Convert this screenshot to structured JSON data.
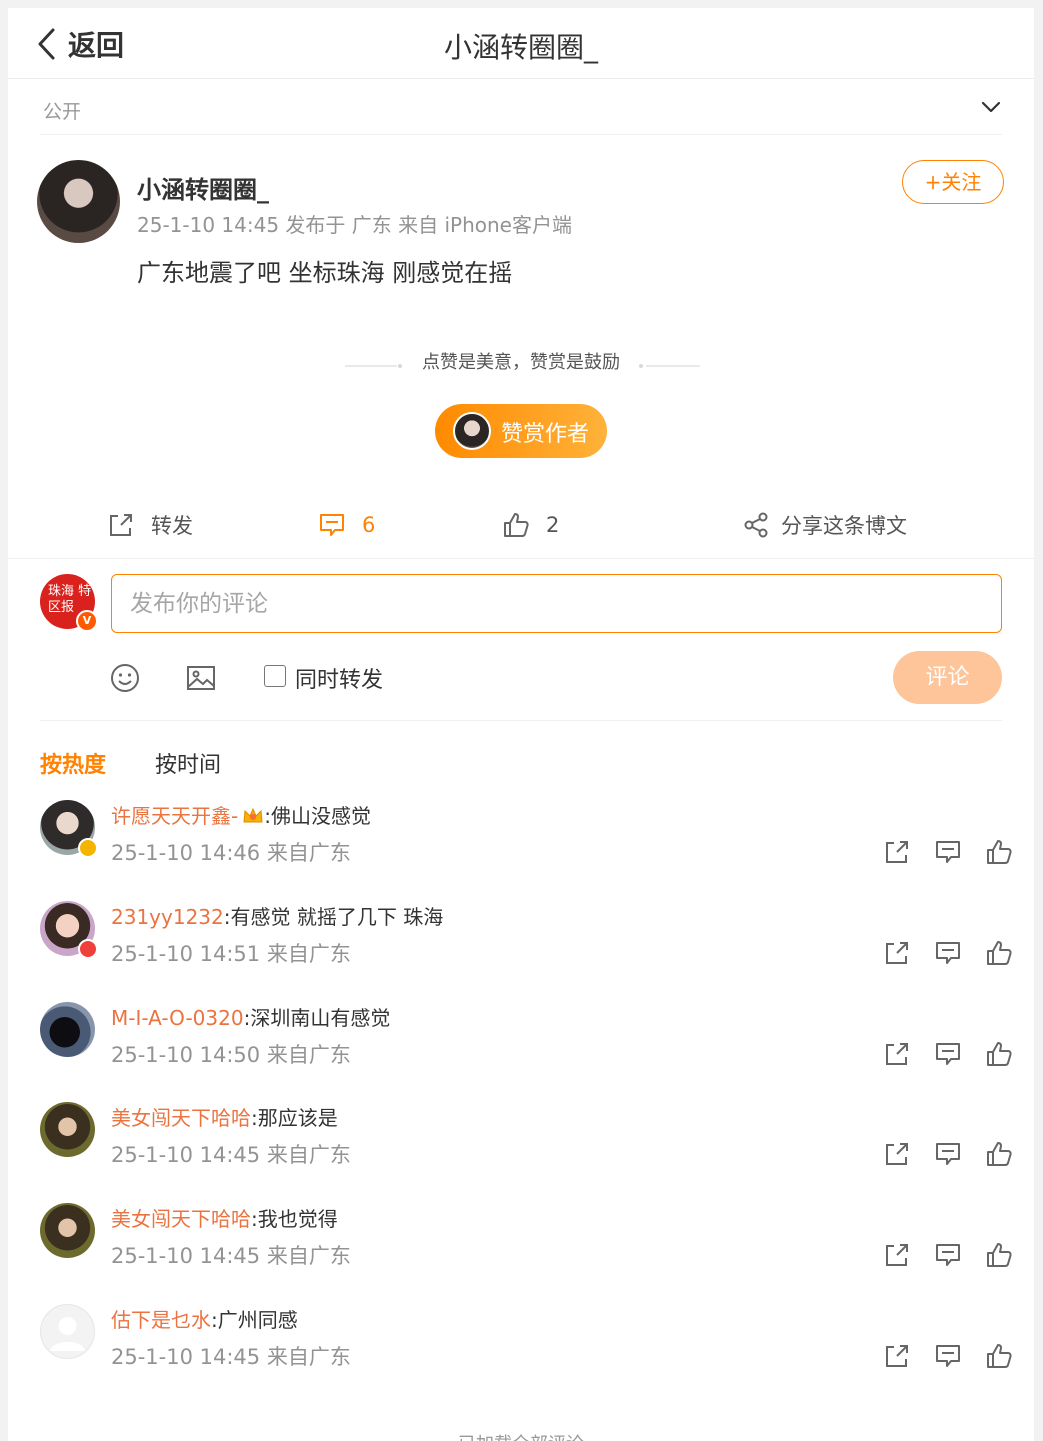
{
  "header": {
    "back_label": "返回",
    "title": "小涵转圈圈_"
  },
  "visibility": {
    "label": "公开"
  },
  "post": {
    "author": "小涵转圈圈_",
    "meta": "25-1-10 14:45 发布于 广东 来自 iPhone客户端",
    "text": "广东地震了吧 坐标珠海 刚感觉在摇",
    "follow_label": "+关注",
    "reward_tip": "点赞是美意，赞赏是鼓励",
    "reward_button": "赞赏作者"
  },
  "actions": {
    "repost_label": "转发",
    "comment_count": "6",
    "like_count": "2",
    "share_label": "分享这条博文"
  },
  "composer": {
    "placeholder": "发布你的评论",
    "my_avatar_text": "珠海 特区报",
    "repost_checkbox_label": "同时转发",
    "submit_label": "评论"
  },
  "sort": {
    "hot": "按热度",
    "time": "按时间"
  },
  "comments": [
    {
      "user": "许愿天天开鑫-",
      "text": ":佛山没感觉",
      "time": "25-1-10 14:46 来自广东"
    },
    {
      "user": "231yy1232",
      "text": ":有感觉 就摇了几下 珠海",
      "time": "25-1-10 14:51 来自广东"
    },
    {
      "user": "M-I-A-O-0320",
      "text": ":深圳南山有感觉",
      "time": "25-1-10 14:50 来自广东"
    },
    {
      "user": "美女闯天下哈哈",
      "text": ":那应该是",
      "time": "25-1-10 14:45 来自广东"
    },
    {
      "user": "美女闯天下哈哈",
      "text": ":我也觉得",
      "time": "25-1-10 14:45 来自广东"
    },
    {
      "user": "估下是乜水",
      "text": ":广州同感",
      "time": "25-1-10 14:45 来自广东"
    }
  ],
  "footer": {
    "tip": "已加载全部评论"
  },
  "colors": {
    "accent": "#ff8200",
    "username": "#eb7340",
    "submit_disabled": "#fec49a"
  }
}
